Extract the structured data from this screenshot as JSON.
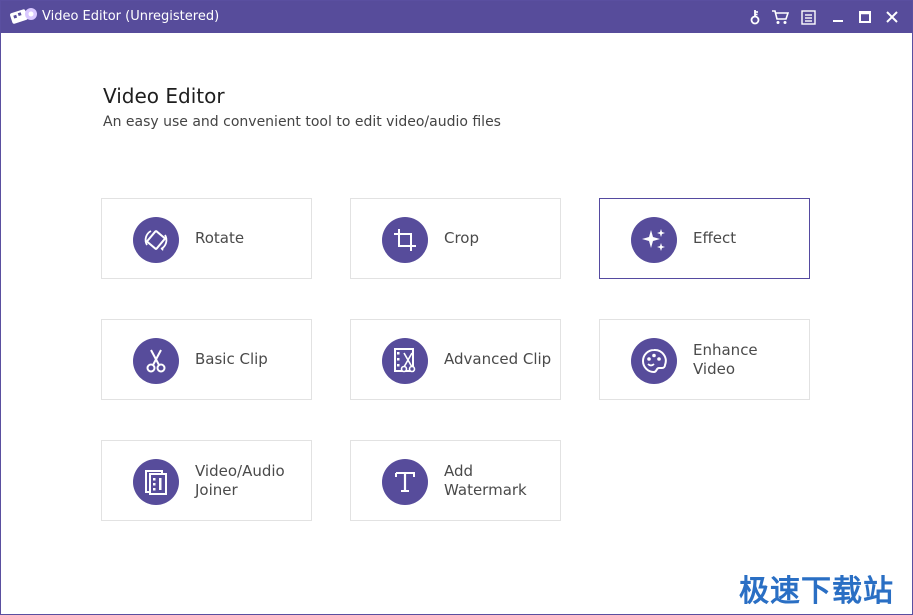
{
  "window": {
    "title": "Video Editor (Unregistered)",
    "accent": "#574c9b"
  },
  "titlebar": {
    "buttons": [
      {
        "name": "register-key-icon"
      },
      {
        "name": "cart-icon"
      },
      {
        "name": "menu-icon"
      },
      {
        "name": "minimize-icon"
      },
      {
        "name": "maximize-icon"
      },
      {
        "name": "close-icon"
      }
    ]
  },
  "main": {
    "heading": "Video Editor",
    "subheading": "An easy use and convenient tool to edit video/audio files",
    "tools": [
      {
        "label": "Rotate",
        "icon": "rotate-icon"
      },
      {
        "label": "Crop",
        "icon": "crop-icon"
      },
      {
        "label": "Effect",
        "icon": "effect-sparkle-icon",
        "selected": true
      },
      {
        "label": "Basic Clip",
        "icon": "scissors-icon"
      },
      {
        "label": "Advanced Clip",
        "icon": "advanced-clip-icon"
      },
      {
        "label": "Enhance\nVideo",
        "icon": "palette-icon"
      },
      {
        "label": "Video/Audio\nJoiner",
        "icon": "joiner-icon"
      },
      {
        "label": "Add\nWatermark",
        "icon": "text-watermark-icon"
      }
    ]
  },
  "watermark_text": "极速下载站"
}
